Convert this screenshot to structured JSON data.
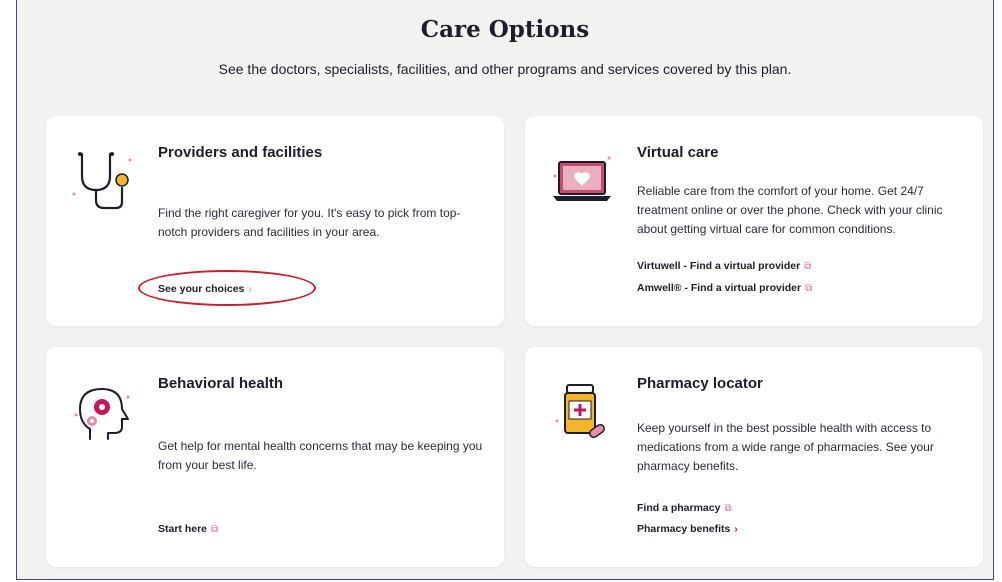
{
  "page": {
    "title": "Care Options",
    "subtitle": "See the doctors, specialists, facilities, and other programs and services covered by this plan."
  },
  "cards": [
    {
      "title": "Providers and facilities",
      "desc": "Find the right caregiver for you. It's easy to pick from top-notch providers and facilities in your area.",
      "icon": "stethoscope-icon",
      "links": [
        {
          "label": "See your choices",
          "icon": "chevron-right-icon"
        }
      ]
    },
    {
      "title": "Virtual care",
      "desc": "Reliable care from the comfort of your home. Get 24/7 treatment online or over the phone. Check with your clinic about getting virtual care for common conditions.",
      "icon": "laptop-heart-icon",
      "links": [
        {
          "label": "Virtuwell - Find a virtual provider",
          "icon": "external-link-icon"
        },
        {
          "label": "Amwell® - Find a virtual provider",
          "icon": "external-link-icon"
        }
      ]
    },
    {
      "title": "Behavioral health",
      "desc": "Get help for mental health concerns that may be keeping you from your best life.",
      "icon": "head-gears-icon",
      "links": [
        {
          "label": "Start here",
          "icon": "external-link-icon"
        }
      ]
    },
    {
      "title": "Pharmacy locator",
      "desc": "Keep yourself in the best possible health with access to medications from a wide range of pharmacies. See your pharmacy benefits.",
      "icon": "pill-bottle-icon",
      "links": [
        {
          "label": "Find a pharmacy",
          "icon": "external-link-icon"
        },
        {
          "label": "Pharmacy benefits",
          "icon": "chevron-right-icon"
        }
      ]
    }
  ],
  "glyphs": {
    "external": "⧉",
    "chevron": "›"
  },
  "colors": {
    "accent": "#c2185b",
    "highlight": "#c8202a",
    "background": "#f4f2f1",
    "frame_border": "#3b4a8f"
  }
}
